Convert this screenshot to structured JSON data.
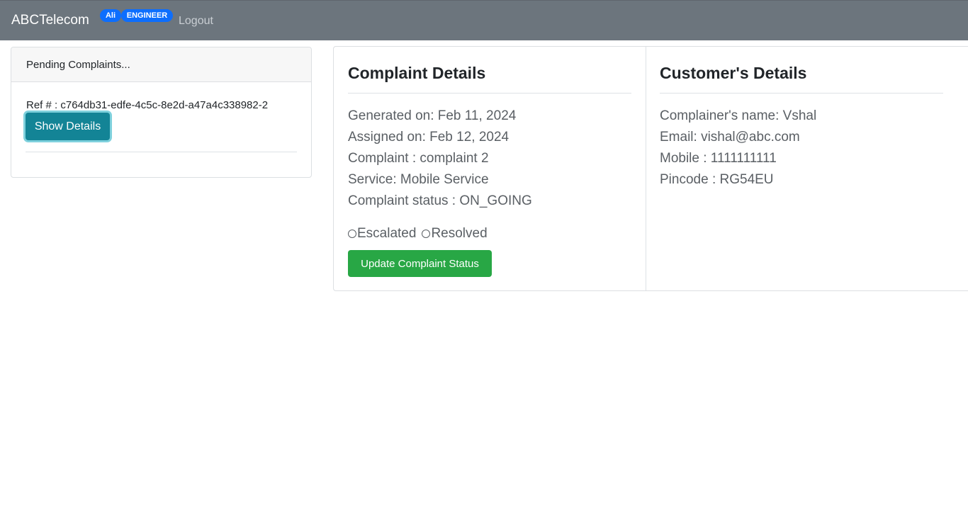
{
  "navbar": {
    "brand": "ABCTelecom",
    "user_badge": "Ali",
    "role_badge": "ENGINEER",
    "logout": "Logout",
    "background_color": "#6c757d",
    "badge_color": "#0d6efd"
  },
  "pending": {
    "header": "Pending Complaints...",
    "items": [
      {
        "ref": "Ref # : c764db31-edfe-4c5c-8e2d-a47a4c338982-2",
        "button": "Show Details"
      }
    ]
  },
  "complaint": {
    "title": "Complaint Details",
    "generated": "Generated on: Feb 11, 2024",
    "assigned": "Assigned on: Feb 12, 2024",
    "complaint": "Complaint : complaint 2",
    "service": "Service: Mobile Service",
    "status": "Complaint status : ON_GOING",
    "options": [
      "Escalated",
      "Resolved"
    ],
    "update_button": "Update Complaint Status",
    "update_button_color": "#28a745"
  },
  "customer": {
    "title": "Customer's Details",
    "name": "Complainer's name: Vshal",
    "email": "Email: vishal@abc.com",
    "mobile": "Mobile : 1111111111",
    "pincode": "Pincode : RG54EU"
  }
}
